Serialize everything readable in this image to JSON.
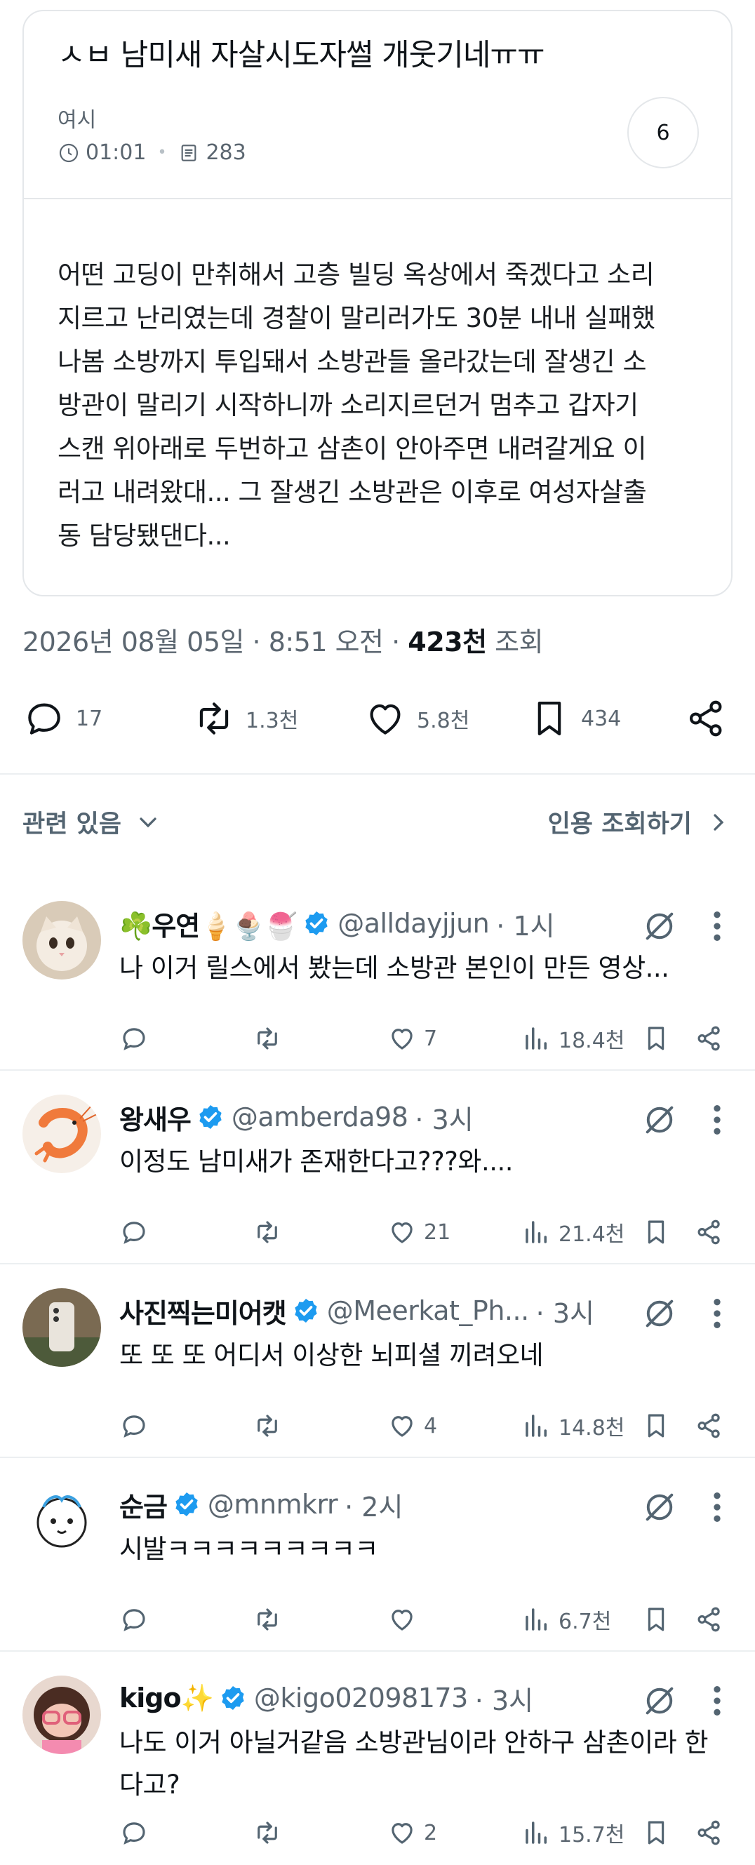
{
  "card": {
    "title": "ㅅㅂ 남미새 자살시도자썰 개웃기네ㅠㅠ",
    "author": "여시",
    "time": "01:01",
    "views": "283",
    "comment_count": "6",
    "body": "어떤 고딩이 만취해서 고층 빌딩 옥상에서 죽겠다고 소리\n지르고 난리였는데 경찰이 말리러가도 30분 내내 실패했\n나봄 소방까지 투입돼서 소방관들 올라갔는데 잘생긴 소\n방관이 말리기 시작하니까 소리지르던거 멈추고 갑자기\n스캔 위아래로 두번하고 삼촌이 안아주면 내려갈게요 이\n러고 내려왔대... 그 잘생긴 소방관은 이후로 여성자살출\n동 담당됐댄다..."
  },
  "post_meta": {
    "date": "2026년 08월 05일 · 8:51 오전 · ",
    "views": "423천",
    "views_label": " 조회"
  },
  "actions": {
    "replies": "17",
    "reposts": "1.3천",
    "likes": "5.8천",
    "bookmarks": "434"
  },
  "related": {
    "label": "관련 있음",
    "quotes": "인용 조회하기"
  },
  "replies": [
    {
      "name": "☘️우연🍦🍨🍧",
      "handle": "@alldayjjun",
      "time": "· 1시",
      "text": "나 이거 릴스에서 봤는데 소방관 본인이 만든 영상...",
      "reply_count": "",
      "repost_count": "",
      "like_count": "7",
      "view_count": "18.4천"
    },
    {
      "name": "왕새우",
      "handle": "@amberda98",
      "time": "· 3시",
      "text": "이정도 남미새가 존재한다고???와....",
      "reply_count": "",
      "repost_count": "",
      "like_count": "21",
      "view_count": "21.4천"
    },
    {
      "name": "사진찍는미어캣",
      "handle": "@Meerkat_Ph...",
      "time": "· 3시",
      "text": "또 또 또 어디서 이상한 뇌피셜 끼려오네",
      "reply_count": "",
      "repost_count": "",
      "like_count": "4",
      "view_count": "14.8천"
    },
    {
      "name": "순금",
      "handle": "@mnmkrr",
      "time": "· 2시",
      "text": "시발ㅋㅋㅋㅋㅋㅋㅋㅋㅋ",
      "reply_count": "",
      "repost_count": "",
      "like_count": "",
      "view_count": "6.7천"
    },
    {
      "name": "kigo✨",
      "handle": "@kigo02098173",
      "time": "· 3시",
      "text": "나도 이거 아닐거같음 소방관님이라 안하구 삼촌이라 한다고?",
      "reply_count": "",
      "repost_count": "",
      "like_count": "2",
      "view_count": "15.7천"
    }
  ],
  "colors": {
    "accent": "#1d9bf0",
    "muted_text": "#536471",
    "border": "#e4e7ea"
  }
}
